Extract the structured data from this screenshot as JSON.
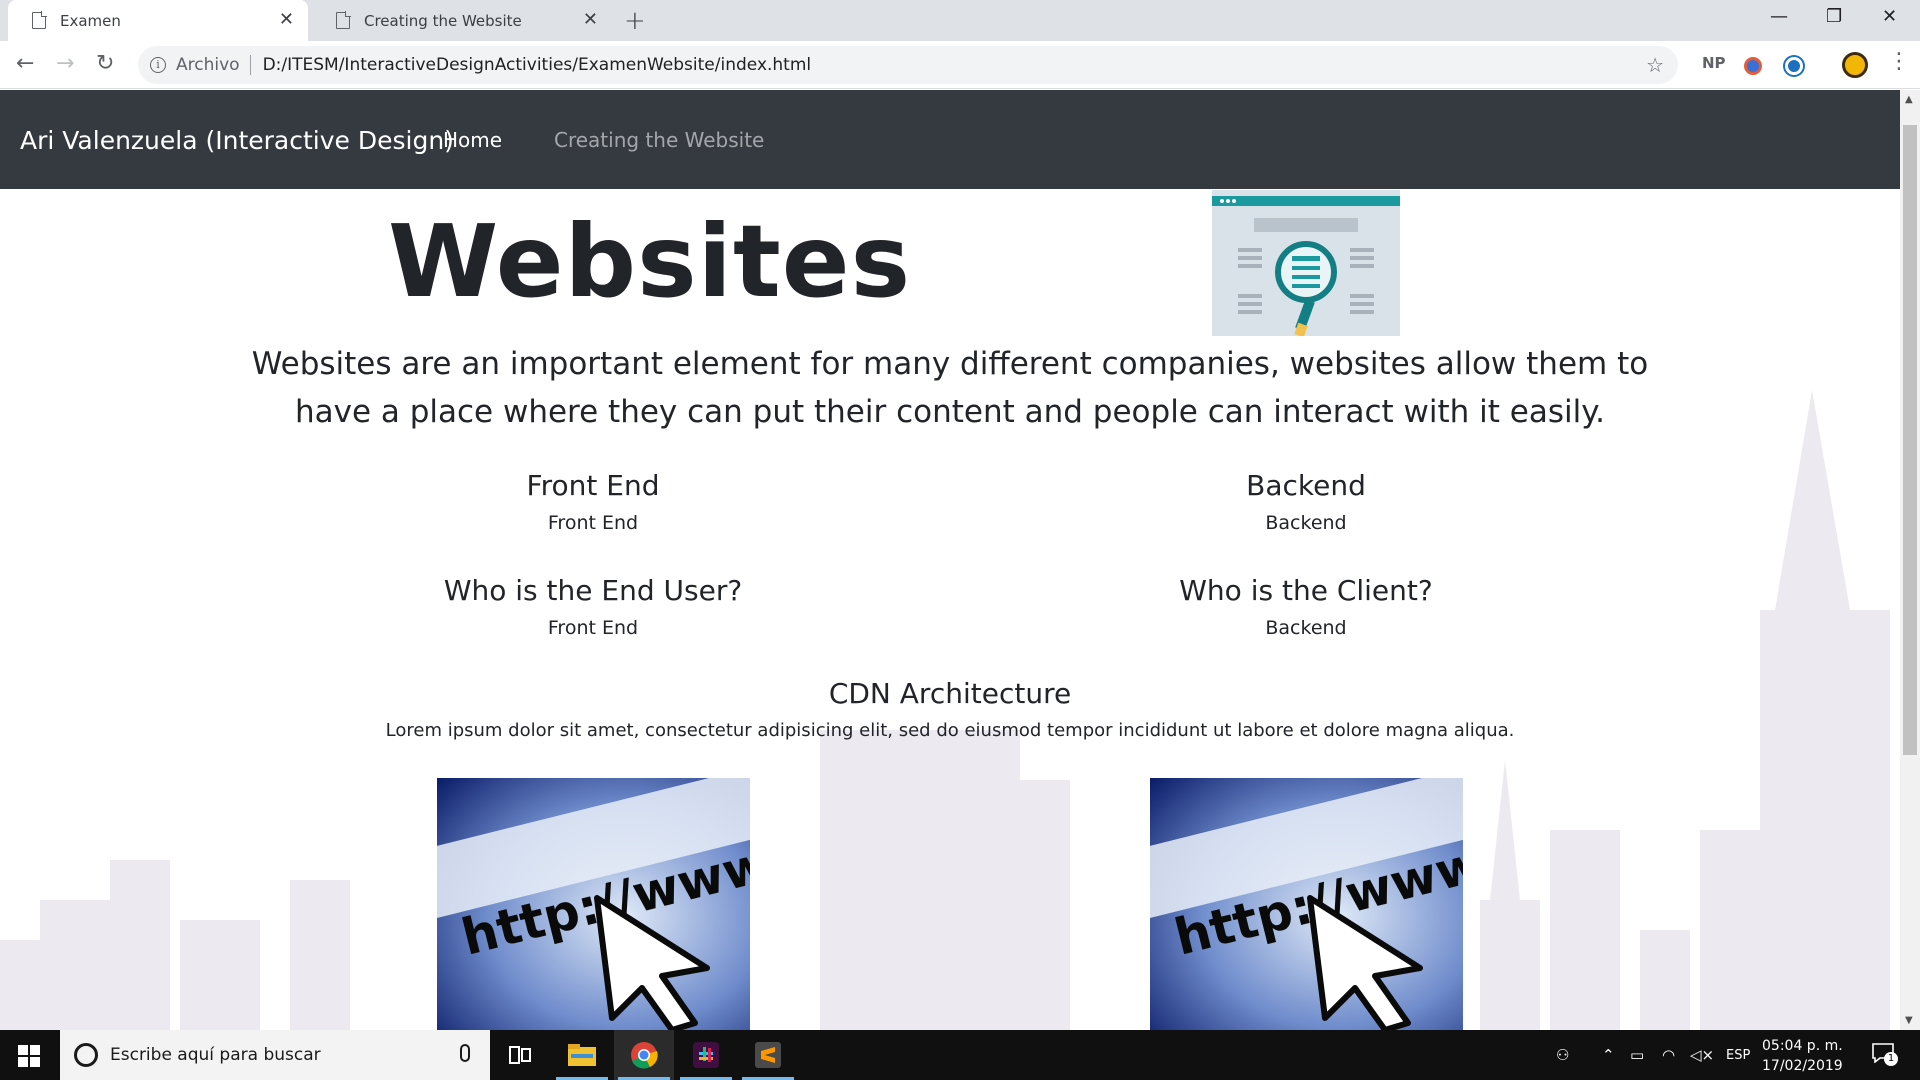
{
  "browser": {
    "tabs": [
      {
        "title": "Examen",
        "active": true
      },
      {
        "title": "Creating the Website",
        "active": false
      }
    ],
    "new_tab": "+",
    "window_controls": {
      "minimize": "—",
      "restore": "❐",
      "close": "✕"
    },
    "address": {
      "scheme_label": "Archivo",
      "url": "D:/ITESM/InteractiveDesignActivities/ExamenWebsite/index.html"
    },
    "extensions": [
      "NP"
    ]
  },
  "page": {
    "navbar": {
      "brand": "Ari Valenzuela (Interactive Design)",
      "links": [
        {
          "label": "Home",
          "active": true
        },
        {
          "label": "Creating the Website",
          "active": false
        }
      ]
    },
    "hero": {
      "title": "Websites",
      "lead": "Websites are an important element for many different companies, websites allow them to have a place where they can put their content and people can interact with it easily."
    },
    "sections": [
      {
        "heading": "Front End",
        "text": "Front End"
      },
      {
        "heading": "Backend",
        "text": "Backend"
      },
      {
        "heading": "Who is the End User?",
        "text": "Front End"
      },
      {
        "heading": "Who is the Client?",
        "text": "Backend"
      }
    ],
    "cdn": {
      "heading": "CDN Architecture",
      "text": "Lorem ipsum dolor sit amet, consectetur adipisicing elit, sed do eiusmod tempor incididunt ut labore et dolore magna aliqua."
    },
    "image_text": "http://www"
  },
  "taskbar": {
    "search_placeholder": "Escribe aquí para buscar",
    "language": "ESP",
    "time": "05:04 p. m.",
    "date": "17/02/2019",
    "notification_count": "1"
  },
  "colors": {
    "navbar_bg": "#343a40",
    "tabstrip_bg": "#dee1e6",
    "taskbar_bg": "#101010"
  }
}
